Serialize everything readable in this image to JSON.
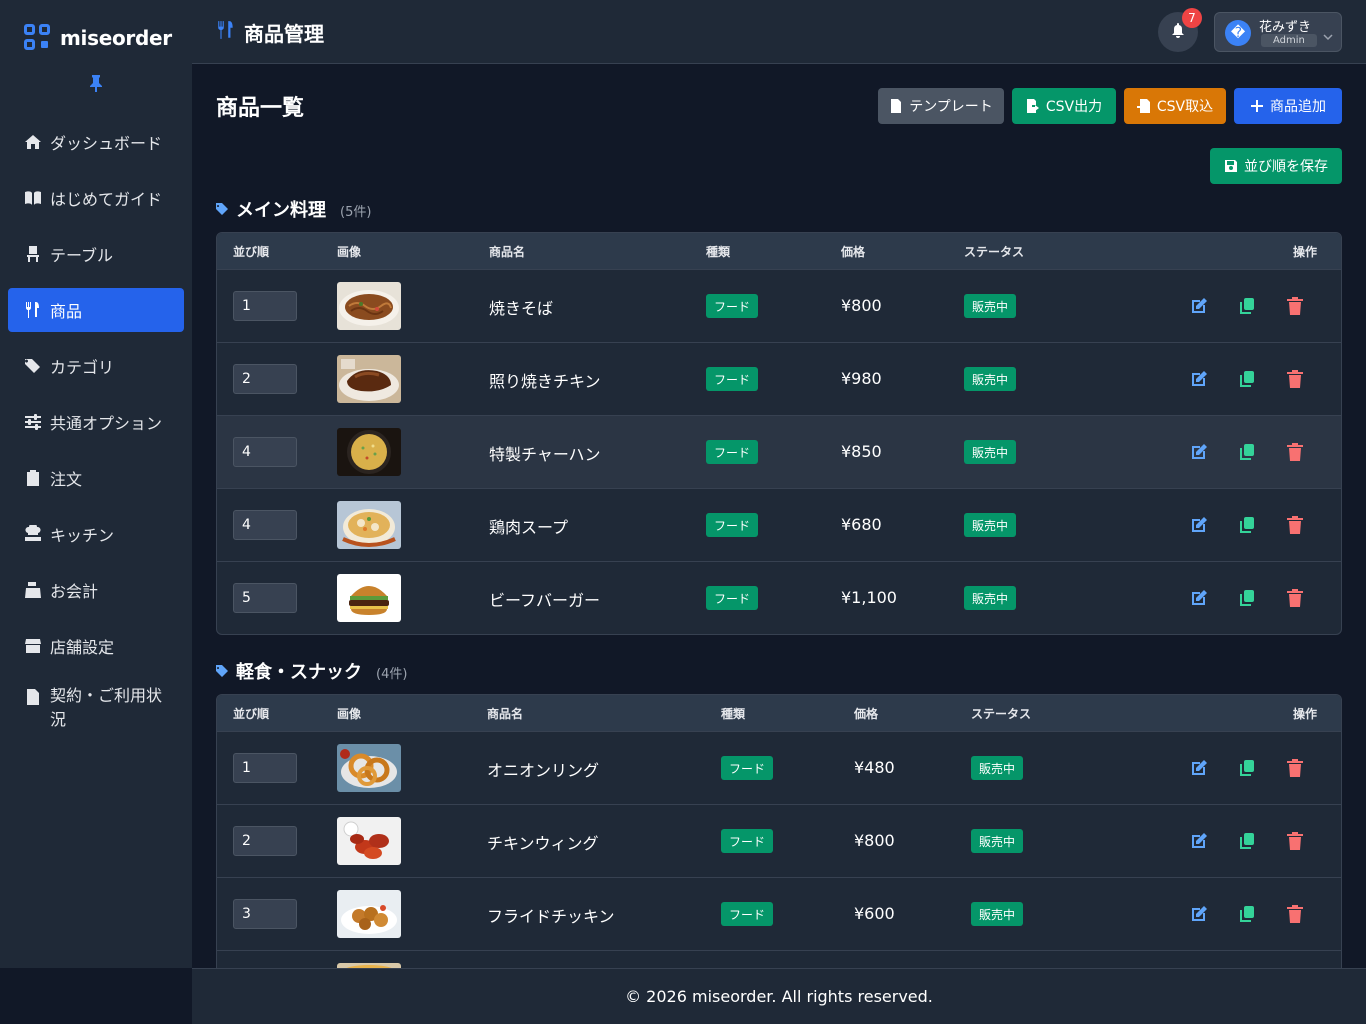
{
  "app": {
    "logo_text": "miseorder"
  },
  "sidebar": {
    "items": [
      {
        "label": "ダッシュボード",
        "icon": "home-icon"
      },
      {
        "label": "はじめてガイド",
        "icon": "book-icon"
      },
      {
        "label": "テーブル",
        "icon": "chair-icon"
      },
      {
        "label": "商品",
        "icon": "utensils-icon",
        "active": true
      },
      {
        "label": "カテゴリ",
        "icon": "tags-icon"
      },
      {
        "label": "共通オプション",
        "icon": "sliders-icon"
      },
      {
        "label": "注文",
        "icon": "clipboard-icon"
      },
      {
        "label": "キッチン",
        "icon": "chef-icon"
      },
      {
        "label": "お会計",
        "icon": "cash-register-icon"
      },
      {
        "label": "店舗設定",
        "icon": "store-icon"
      },
      {
        "label": "契約・ご利用状況",
        "icon": "contract-icon"
      }
    ]
  },
  "header": {
    "title": "商品管理",
    "notification_count": "7",
    "user_name": "花みずき",
    "user_role": "Admin",
    "avatar_glyph": "�"
  },
  "main": {
    "title": "商品一覧",
    "buttons": {
      "template": "テンプレート",
      "csv_export": "CSV出力",
      "csv_import": "CSV取込",
      "add_product": "商品追加",
      "save_order": "並び順を保存"
    },
    "columns": {
      "order": "並び順",
      "image": "画像",
      "name": "商品名",
      "type": "種類",
      "price": "価格",
      "status": "ステータス",
      "actions": "操作"
    },
    "sections": [
      {
        "name": "メイン料理",
        "count": "(5件)",
        "rows": [
          {
            "order": "1",
            "name": "焼きそば",
            "type": "フード",
            "price": "¥800",
            "status": "販売中",
            "image": "yakisoba-photo"
          },
          {
            "order": "2",
            "name": "照り焼きチキン",
            "type": "フード",
            "price": "¥980",
            "status": "販売中",
            "image": "teriyaki-chicken-photo"
          },
          {
            "order": "4",
            "name": "特製チャーハン",
            "type": "フード",
            "price": "¥850",
            "status": "販売中",
            "image": "fried-rice-photo"
          },
          {
            "order": "4",
            "name": "鶏肉スープ",
            "type": "フード",
            "price": "¥680",
            "status": "販売中",
            "image": "chicken-soup-photo"
          },
          {
            "order": "5",
            "name": "ビーフバーガー",
            "type": "フード",
            "price": "¥1,100",
            "status": "販売中",
            "image": "beef-burger-photo"
          }
        ]
      },
      {
        "name": "軽食・スナック",
        "count": "(4件)",
        "rows": [
          {
            "order": "1",
            "name": "オニオンリング",
            "type": "フード",
            "price": "¥480",
            "status": "販売中",
            "image": "onion-rings-photo"
          },
          {
            "order": "2",
            "name": "チキンウィング",
            "type": "フード",
            "price": "¥800",
            "status": "販売中",
            "image": "chicken-wings-photo"
          },
          {
            "order": "3",
            "name": "フライドチッキン",
            "type": "フード",
            "price": "¥600",
            "status": "販売中",
            "image": "fried-chicken-photo"
          }
        ]
      }
    ]
  },
  "footer": {
    "text": "© 2026 miseorder. All rights reserved."
  },
  "colors": {
    "background": "#111827",
    "panel": "#1f2937",
    "accent_blue": "#2563eb",
    "green": "#059669",
    "orange": "#d97706",
    "gray_button": "#4b5563",
    "edit_icon": "#60a5fa",
    "copy_icon": "#34d399",
    "delete_icon": "#f87171"
  }
}
